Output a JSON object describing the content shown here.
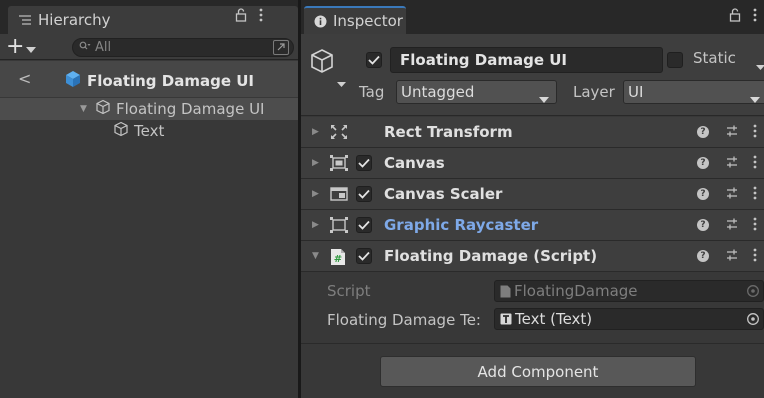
{
  "hierarchy": {
    "tab_label": "Hierarchy",
    "search_placeholder": "All",
    "scene_title": "Floating Damage UI",
    "tree": [
      {
        "label": "Floating Damage UI",
        "selected": true
      },
      {
        "label": "Text",
        "selected": false
      }
    ]
  },
  "inspector": {
    "tab_label": "Inspector",
    "object_name": "Floating Damage UI",
    "active": true,
    "static_label": "Static",
    "tag_label": "Tag",
    "tag_value": "Untagged",
    "layer_label": "Layer",
    "layer_value": "UI",
    "components": [
      {
        "title": "Rect Transform",
        "has_checkbox": false,
        "expanded": false,
        "icon": "rect-transform-icon"
      },
      {
        "title": "Canvas",
        "has_checkbox": true,
        "expanded": false,
        "icon": "canvas-icon"
      },
      {
        "title": "Canvas Scaler",
        "has_checkbox": true,
        "expanded": false,
        "icon": "canvas-scaler-icon"
      },
      {
        "title": "Graphic Raycaster",
        "has_checkbox": true,
        "expanded": false,
        "icon": "graphic-raycaster-icon",
        "highlight": true
      },
      {
        "title": "Floating Damage (Script)",
        "has_checkbox": true,
        "expanded": true,
        "icon": "script-icon"
      }
    ],
    "script_fields": {
      "script_label": "Script",
      "script_value": "FloatingDamage",
      "field_label": "Floating Damage Te:",
      "field_value": "Text (Text)"
    },
    "add_component_label": "Add Component"
  },
  "colors": {
    "panel_bg": "#383838",
    "header_bg": "#3e3e3e",
    "field_bg": "#2a2a2a",
    "selected_row": "#4d4d4d",
    "accent_blue": "#3a79bb",
    "link_blue": "#7ea9e8"
  }
}
